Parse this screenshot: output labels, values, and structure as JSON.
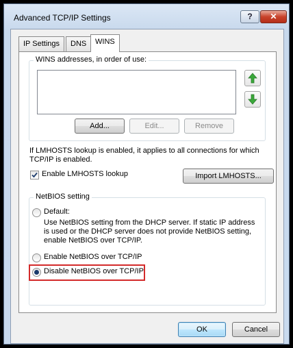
{
  "window": {
    "title": "Advanced TCP/IP Settings",
    "help_glyph": "?",
    "close_glyph": "✕"
  },
  "tabs": [
    {
      "label": "IP Settings"
    },
    {
      "label": "DNS"
    },
    {
      "label": "WINS"
    }
  ],
  "wins": {
    "group_label": "WINS addresses, in order of use:",
    "up_glyph": "⬆",
    "down_glyph": "⬇",
    "add_label": "Add...",
    "edit_label": "Edit...",
    "remove_label": "Remove"
  },
  "lmhosts": {
    "info_line1": "If LMHOSTS lookup is enabled, it applies to all connections for which",
    "info_line2": "TCP/IP is enabled.",
    "enable_label": "Enable LMHOSTS lookup",
    "enable_checked": true,
    "import_label": "Import LMHOSTS..."
  },
  "netbios": {
    "group_label": "NetBIOS setting",
    "default_label": "Default:",
    "default_desc_1": "Use NetBIOS setting from the DHCP server. If static IP address",
    "default_desc_2": "is used or the DHCP server does not provide NetBIOS setting,",
    "default_desc_3": "enable NetBIOS over TCP/IP.",
    "enable_label": "Enable NetBIOS over TCP/IP",
    "disable_label": "Disable NetBIOS over TCP/IP",
    "selected": "disable"
  },
  "footer": {
    "ok_label": "OK",
    "cancel_label": "Cancel"
  },
  "colors": {
    "highlight": "#d32a2a",
    "arrow_green": "#3aa83a"
  }
}
